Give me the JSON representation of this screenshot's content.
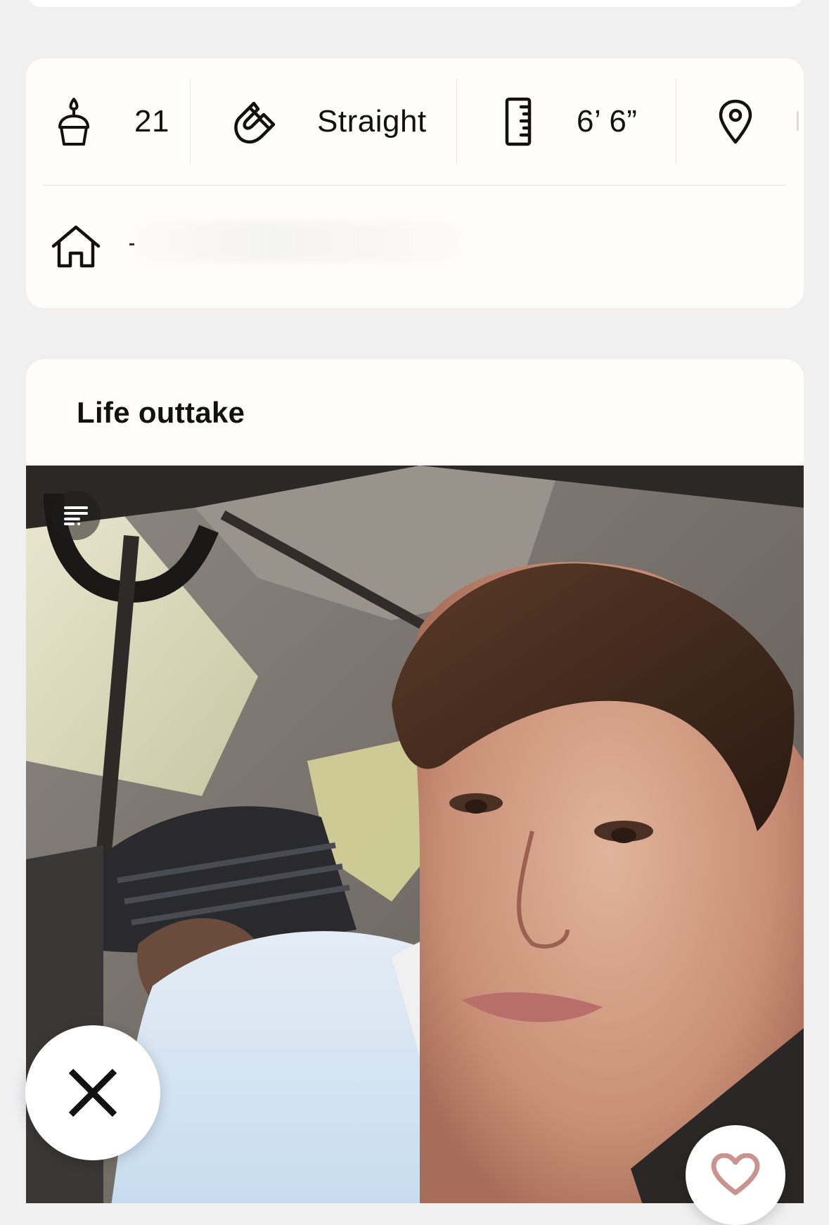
{
  "vitals": {
    "age": {
      "icon": "birthday-cake-icon",
      "value": "21"
    },
    "sexuality": {
      "icon": "magnet-icon",
      "value": "Straight"
    },
    "height": {
      "icon": "ruler-icon",
      "value": "6’ 6”"
    },
    "location": {
      "icon": "location-pin-icon",
      "value": ""
    }
  },
  "hometown": {
    "icon": "house-icon",
    "value": ""
  },
  "prompt": {
    "title": "Life outtake",
    "caption_icon": "caption-lines-icon"
  },
  "actions": {
    "dismiss_icon": "close-icon",
    "like_icon": "heart-icon"
  },
  "colors": {
    "page_background": "#f0f0f1",
    "card_background": "#fffefc",
    "text": "#111111",
    "divider": "#e2e2e2"
  }
}
